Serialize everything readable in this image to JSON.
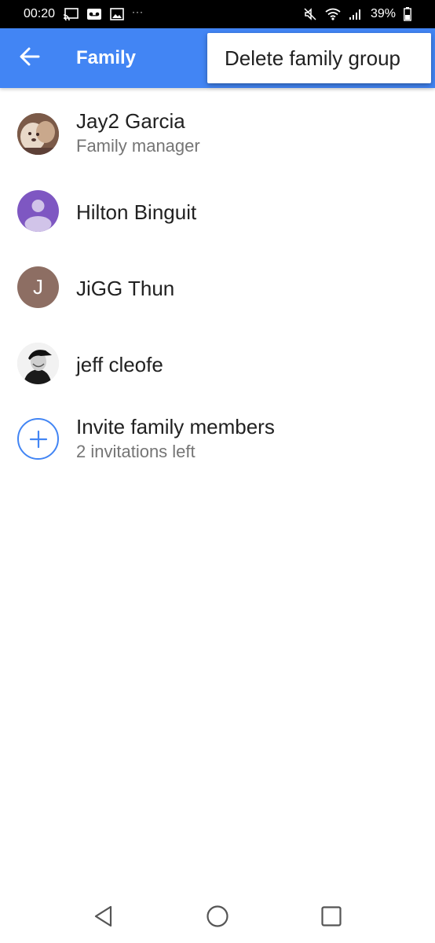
{
  "status_bar": {
    "time": "00:20",
    "battery_percent": "39%",
    "icons": [
      "cast-icon",
      "voicemail-icon",
      "image-icon",
      "more-dots-icon",
      "mute-icon",
      "wifi-icon",
      "signal-icon",
      "battery-icon"
    ]
  },
  "app_bar": {
    "title": "Family",
    "color": "#4285f4"
  },
  "overflow_menu": {
    "items": [
      {
        "label": "Delete family group"
      }
    ]
  },
  "members": [
    {
      "name": "Jay2 Garcia",
      "subtitle": "Family manager",
      "avatar": "photo"
    },
    {
      "name": "Hilton Binguit",
      "subtitle": "",
      "avatar": "default-person"
    },
    {
      "name": "JiGG Thun",
      "subtitle": "",
      "avatar": "letter",
      "initial": "J"
    },
    {
      "name": "jeff cleofe",
      "subtitle": "",
      "avatar": "photo"
    }
  ],
  "invite": {
    "label": "Invite family members",
    "subtitle": "2 invitations left"
  },
  "nav_bar": {
    "buttons": [
      "back-triangle-icon",
      "home-circle-icon",
      "recents-square-icon"
    ]
  }
}
